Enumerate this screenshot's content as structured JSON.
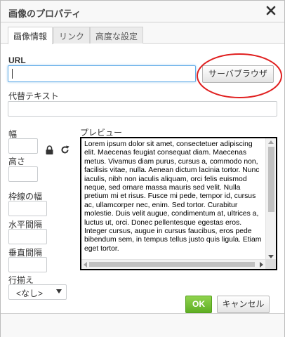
{
  "dialog": {
    "title": "画像のプロパティ",
    "close_icon": "close-icon"
  },
  "tabs": [
    {
      "label": "画像情報",
      "active": true
    },
    {
      "label": "リンク",
      "active": false
    },
    {
      "label": "高度な設定",
      "active": false
    }
  ],
  "form": {
    "url_label": "URL",
    "url_value": "",
    "browse_label": "サーバブラウザ",
    "alt_label": "代替テキスト",
    "alt_value": "",
    "width_label": "幅",
    "height_label": "高さ",
    "border_label": "枠線の幅",
    "hspace_label": "水平間隔",
    "vspace_label": "垂直間隔",
    "align_label": "行揃え",
    "align_value": "<なし>",
    "lock_icon": "lock-icon",
    "reset_icon": "reset-size-icon"
  },
  "preview": {
    "label": "プレビュー",
    "text": "Lorem ipsum dolor sit amet, consectetuer adipiscing elit. Maecenas feugiat consequat diam. Maecenas metus. Vivamus diam purus, cursus a, commodo non, facilisis vitae, nulla. Aenean dictum lacinia tortor. Nunc iaculis, nibh non iaculis aliquam, orci felis euismod neque, sed ornare massa mauris sed velit. Nulla pretium mi et risus. Fusce mi pede, tempor id, cursus ac, ullamcorper nec, enim. Sed tortor. Curabitur molestie. Duis velit augue, condimentum at, ultrices a, luctus ut, orci. Donec pellentesque egestas eros. Integer cursus, augue in cursus faucibus, eros pede bibendum sem, in tempus tellus justo quis ligula. Etiam eget tortor."
  },
  "footer": {
    "ok_label": "OK",
    "cancel_label": "キャンセル"
  },
  "colors": {
    "ok_green": "#6cbf2e",
    "highlight_circle": "#e02020",
    "focus_blue": "#66afe9"
  }
}
